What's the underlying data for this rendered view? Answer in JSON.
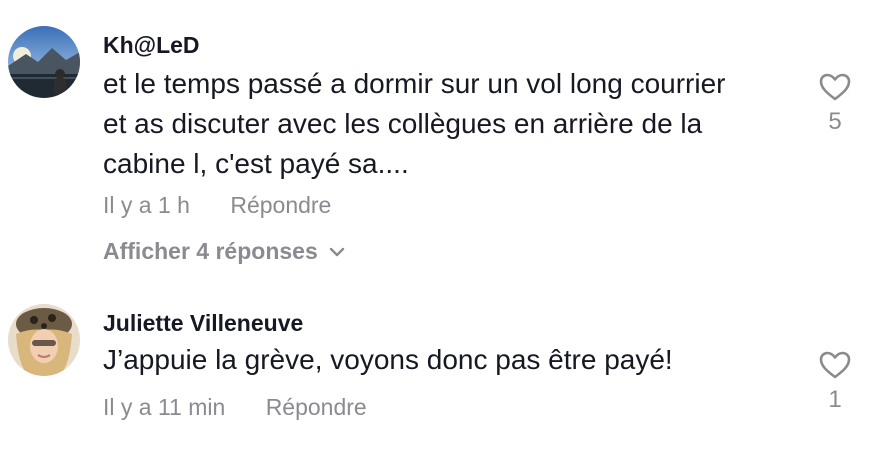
{
  "comments": [
    {
      "username": "Kh@LeD",
      "text_lines": [
        "et le temps passé a dormir sur un vol long courrier",
        "et as discuter avec les collègues en arrière de la",
        "cabine l, c'est payé sa...."
      ],
      "time": "Il y a 1 h",
      "reply_label": "Répondre",
      "view_replies_label": "Afficher 4 réponses",
      "like_count": "5"
    },
    {
      "username": "Juliette Villeneuve",
      "text_lines": [
        "J’appuie la grève, voyons donc pas être payé!"
      ],
      "time": "Il y a 11 min",
      "reply_label": "Répondre",
      "like_count": "1"
    }
  ]
}
